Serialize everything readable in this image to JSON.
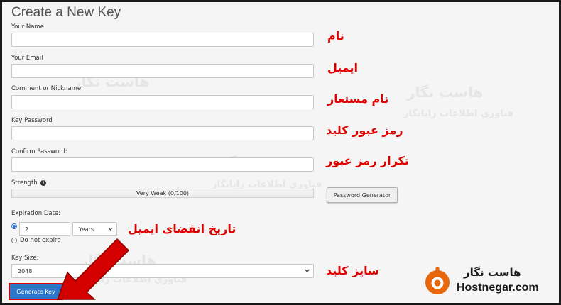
{
  "page_title": "Create a New Key",
  "fields": {
    "name_label": "Your Name",
    "email_label": "Your Email",
    "comment_label": "Comment or Nickname:",
    "password_label": "Key Password",
    "confirm_label": "Confirm Password:"
  },
  "strength": {
    "label": "Strength",
    "meter_text": "Very Weak (0/100)",
    "generator_button": "Password Generator"
  },
  "expiration": {
    "label": "Expiration Date:",
    "value": "2",
    "unit": "Years",
    "no_expire": "Do not expire"
  },
  "key_size": {
    "label": "Key Size:",
    "value": "2048"
  },
  "generate_button": "Generate Key",
  "annotations": {
    "name": "نام",
    "email": "ایمیل",
    "nickname": "نام مستعار",
    "password": "رمز عبور کلید",
    "confirm": "تکرار رمز عبور",
    "expiration": "تاریخ انقضای ایمیل",
    "key_size": "سایز کلید"
  },
  "brand": {
    "name_fa": "هاست نگار",
    "site": "Hostnegar.com",
    "watermark_sub": "فناوری اطلاعات رایانگار",
    "accent": "#e8660c"
  },
  "colors": {
    "annotation": "#e00000",
    "primary_button": "#2a77c9",
    "arrow": "#d40000"
  }
}
